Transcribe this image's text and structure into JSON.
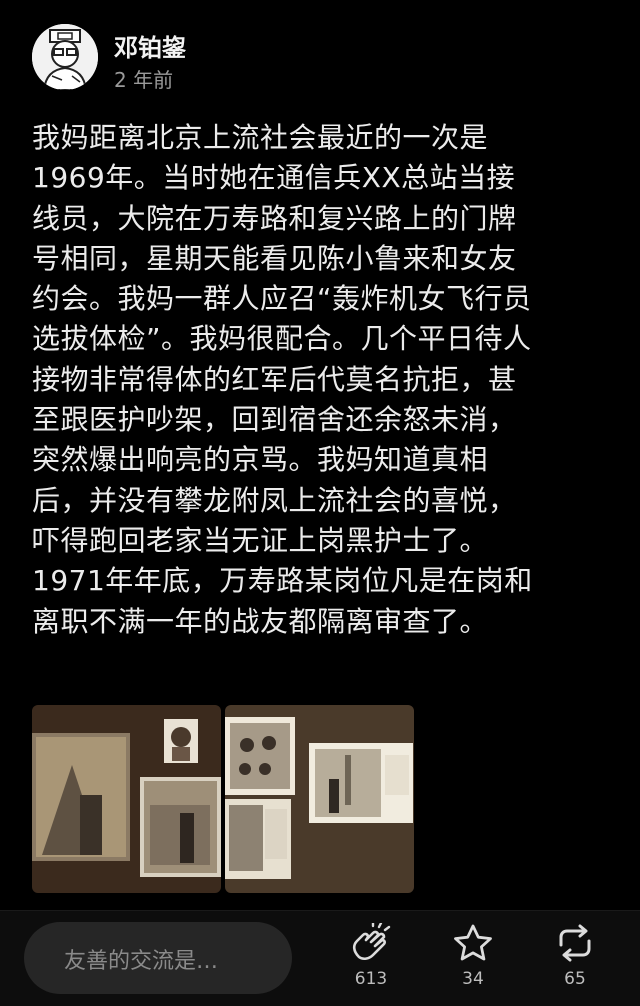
{
  "post": {
    "author": "邓铂鋆",
    "time": "2 年前",
    "text": "我妈距离北京上流社会最近的一次是\n1969年。当时她在通信兵XX总站当接\n线员，大院在万寿路和复兴路上的门牌\n号相同，星期天能看见陈小鲁来和女友\n约会。我妈一群人应召“轰炸机女飞行员\n选拔体检”。我妈很配合。几个平日待人\n接物非常得体的红军后代莫名抗拒，甚\n至跟医护吵架，回到宿舍还余怒未消，\n突然爆出响亮的京骂。我妈知道真相\n后，并没有攀龙附凤上流社会的喜悦，\n吓得跑回老家当无证上岗黑护士了。\n1971年年底，万寿路某岗位凡是在岗和\n离职不满一年的战友都隔离审查了。"
  },
  "bottom_bar": {
    "comment_placeholder": "友善的交流是…",
    "clap_count": "613",
    "star_count": "34",
    "repost_count": "65"
  },
  "colors": {
    "background": "#000000",
    "text": "#ececec",
    "muted": "#9a9a9a",
    "bar": "#0d0d0d",
    "input": "#262626"
  }
}
